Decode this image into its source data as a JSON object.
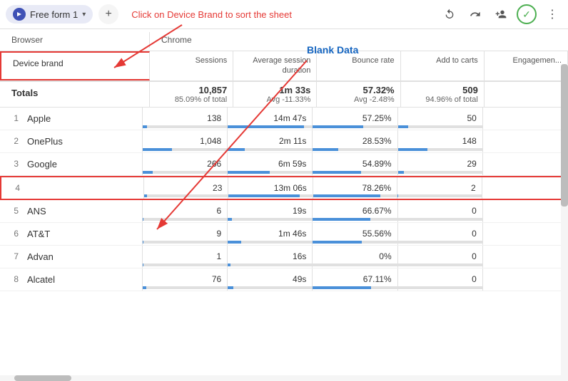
{
  "header": {
    "form_label": "Free form 1",
    "add_label": "+",
    "annotation": "Click on Device Brand to sort the sheet",
    "blank_data_annotation": "Blank Data"
  },
  "sub_header": {
    "left": "Browser",
    "right": "Chrome"
  },
  "columns": {
    "device_brand": "Device brand",
    "sessions": "Sessions",
    "avg_session": "Average session duration",
    "bounce_rate": "Bounce rate",
    "add_to_carts": "Add to carts",
    "engagement": "Engagemen..."
  },
  "totals": {
    "label": "Totals",
    "sessions": "10,857",
    "sessions_sub": "85.09% of total",
    "avg_session": "1m 33s",
    "avg_session_sub": "Avg -11.33%",
    "bounce_rate": "57.32%",
    "bounce_rate_sub": "Avg -2.48%",
    "add_to_carts": "509",
    "add_to_carts_sub": "94.96% of total"
  },
  "rows": [
    {
      "num": "1",
      "label": "Apple",
      "sessions": "138",
      "avg_session": "14m 47s",
      "bounce_rate": "57.25%",
      "add_to_carts": "50",
      "sessions_pct": 5,
      "avg_pct": 90,
      "bounce_pct": 60,
      "carts_pct": 12,
      "blank": false
    },
    {
      "num": "2",
      "label": "OnePlus",
      "sessions": "1,048",
      "avg_session": "2m 11s",
      "bounce_rate": "28.53%",
      "add_to_carts": "148",
      "sessions_pct": 35,
      "avg_pct": 20,
      "bounce_pct": 30,
      "carts_pct": 35,
      "blank": false
    },
    {
      "num": "3",
      "label": "Google",
      "sessions": "266",
      "avg_session": "6m 59s",
      "bounce_rate": "54.89%",
      "add_to_carts": "29",
      "sessions_pct": 12,
      "avg_pct": 50,
      "bounce_pct": 57,
      "carts_pct": 7,
      "blank": false
    },
    {
      "num": "4",
      "label": "",
      "sessions": "23",
      "avg_session": "13m 06s",
      "bounce_rate": "78.26%",
      "add_to_carts": "2",
      "sessions_pct": 3,
      "avg_pct": 85,
      "bounce_pct": 80,
      "carts_pct": 1,
      "blank": true
    },
    {
      "num": "5",
      "label": "ANS",
      "sessions": "6",
      "avg_session": "19s",
      "bounce_rate": "66.67%",
      "add_to_carts": "0",
      "sessions_pct": 1,
      "avg_pct": 5,
      "bounce_pct": 68,
      "carts_pct": 0,
      "blank": false
    },
    {
      "num": "6",
      "label": "AT&T",
      "sessions": "9",
      "avg_session": "1m 46s",
      "bounce_rate": "55.56%",
      "add_to_carts": "0",
      "sessions_pct": 1,
      "avg_pct": 16,
      "bounce_pct": 58,
      "carts_pct": 0,
      "blank": false
    },
    {
      "num": "7",
      "label": "Advan",
      "sessions": "1",
      "avg_session": "16s",
      "bounce_rate": "0%",
      "add_to_carts": "0",
      "sessions_pct": 1,
      "avg_pct": 3,
      "bounce_pct": 0,
      "carts_pct": 0,
      "blank": false
    },
    {
      "num": "8",
      "label": "Alcatel",
      "sessions": "76",
      "avg_session": "49s",
      "bounce_rate": "67.11%",
      "add_to_carts": "0",
      "sessions_pct": 4,
      "avg_pct": 7,
      "bounce_pct": 69,
      "carts_pct": 0,
      "blank": false
    }
  ]
}
